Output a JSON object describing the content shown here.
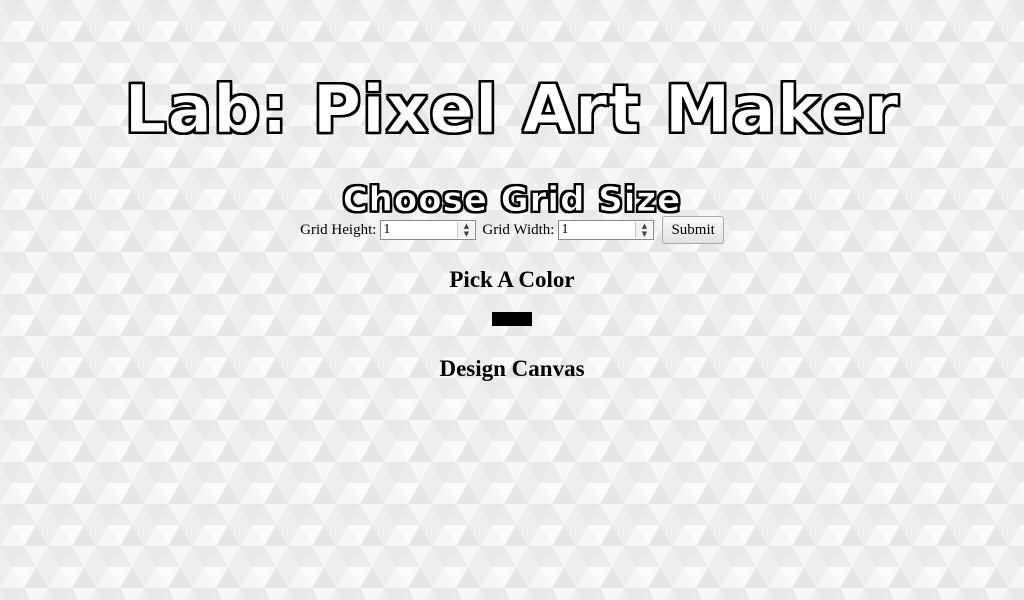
{
  "page": {
    "title": "Lab: Pixel Art Maker"
  },
  "grid_form": {
    "heading": "Choose Grid Size",
    "height_label": "Grid Height:",
    "height_value": "1",
    "width_label": "Grid Width:",
    "width_value": "1",
    "submit_label": "Submit"
  },
  "color_picker": {
    "heading": "Pick A Color",
    "selected_color": "#000000"
  },
  "canvas": {
    "heading": "Design Canvas"
  },
  "icons": {
    "spin_up": "▲",
    "spin_down": "▼"
  }
}
